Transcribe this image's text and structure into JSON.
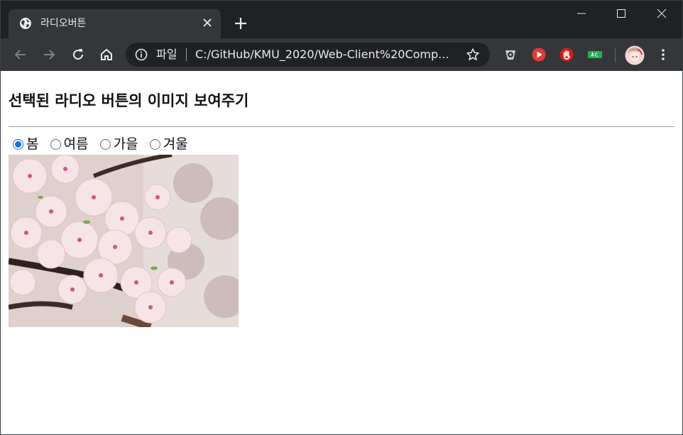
{
  "browser": {
    "tab": {
      "title": "라디오버튼"
    },
    "omnibox": {
      "scheme_label": "파일",
      "url": "C:/GitHub/KMU_2020/Web-Client%20Comp..."
    },
    "colors": {
      "frame": "#202124",
      "toolbar": "#35363a",
      "omnibox": "#202124"
    },
    "icons": [
      "globe-icon",
      "close-icon",
      "plus-icon",
      "minimize-icon",
      "maximize-icon",
      "window-close-icon",
      "back-arrow-icon",
      "forward-arrow-icon",
      "reload-icon",
      "home-icon",
      "info-icon",
      "star-icon",
      "extension-icon",
      "menu-kebab-icon"
    ]
  },
  "page": {
    "heading": "선택된 라디오 버튼의 이미지 보여주기",
    "radios": [
      {
        "label": "봄",
        "checked": true
      },
      {
        "label": "여름",
        "checked": false
      },
      {
        "label": "가을",
        "checked": false
      },
      {
        "label": "겨울",
        "checked": false
      }
    ],
    "image": {
      "subject": "cherry blossoms"
    }
  }
}
